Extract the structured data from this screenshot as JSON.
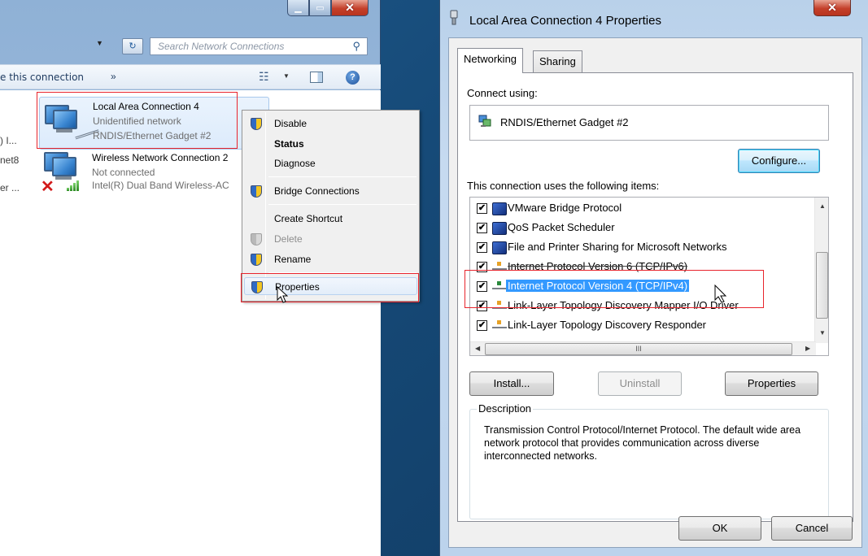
{
  "left_window": {
    "search_placeholder": "Search Network Connections",
    "toolbar": {
      "action_label": "e this connection",
      "more_label": "»"
    },
    "connections": [
      {
        "title": "Local Area Connection 4",
        "status": "Unidentified network",
        "device": "RNDIS/Ethernet Gadget #2"
      },
      {
        "title": "Wireless Network Connection 2",
        "status": "Not connected",
        "device": "Intel(R) Dual Band Wireless-AC"
      }
    ],
    "cut_labels": [
      ") I...",
      "net8",
      "er ..."
    ]
  },
  "context_menu": {
    "items": [
      {
        "label": "Disable"
      },
      {
        "label": "Status"
      },
      {
        "label": "Diagnose"
      },
      {
        "label": "Bridge Connections"
      },
      {
        "label": "Create Shortcut"
      },
      {
        "label": "Delete"
      },
      {
        "label": "Rename"
      },
      {
        "label": "Properties"
      }
    ]
  },
  "dialog": {
    "title": "Local Area Connection 4 Properties",
    "tabs": [
      "Networking",
      "Sharing"
    ],
    "connect_using_label": "Connect using:",
    "adapter_name": "RNDIS/Ethernet Gadget #2",
    "configure_button": "Configure...",
    "items_label": "This connection uses the following items:",
    "items": [
      {
        "label": "VMware Bridge Protocol",
        "checked": "✔"
      },
      {
        "label": "QoS Packet Scheduler",
        "checked": "✔"
      },
      {
        "label": "File and Printer Sharing for Microsoft Networks",
        "checked": "✔"
      },
      {
        "label": "Internet Protocol Version 6 (TCP/IPv6)",
        "checked": "✔"
      },
      {
        "label": "Internet Protocol Version 4 (TCP/IPv4)",
        "checked": "✔"
      },
      {
        "label": "Link-Layer Topology Discovery Mapper I/O Driver",
        "checked": "✔"
      },
      {
        "label": "Link-Layer Topology Discovery Responder",
        "checked": "✔"
      }
    ],
    "hscroll_grip": "III",
    "install_button": "Install...",
    "uninstall_button": "Uninstall",
    "properties_button": "Properties",
    "description_label": "Description",
    "description_text": "Transmission Control Protocol/Internet Protocol. The default wide area network protocol that provides communication across diverse interconnected networks.",
    "ok_button": "OK",
    "cancel_button": "Cancel"
  },
  "colors": {
    "highlight_box": "#e8242c",
    "selection": "#3399ff"
  }
}
